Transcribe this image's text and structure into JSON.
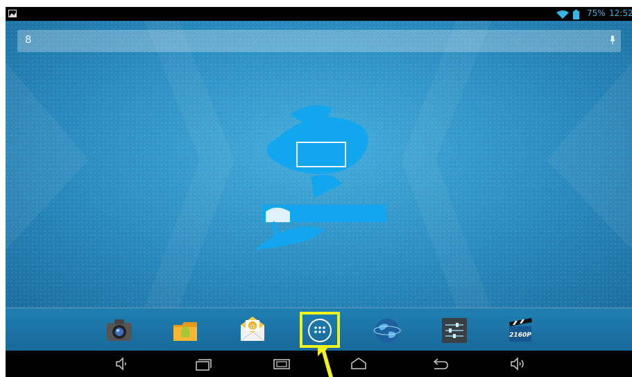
{
  "status_bar": {
    "battery_percent": "75%",
    "time": "12:52",
    "icons": [
      "notification-image-icon",
      "wifi-icon",
      "battery-icon"
    ]
  },
  "search_bar": {
    "google_glyph": "8",
    "icons": [
      "google-search-icon",
      "microphone-icon"
    ]
  },
  "dock": {
    "apps": [
      "camera-icon",
      "file-manager-icon",
      "email-icon",
      "all-apps-icon",
      "browser-globe-icon",
      "settings-icon",
      "video-player-icon"
    ],
    "video_player_badge": "2160P",
    "highlighted": "all-apps-icon"
  },
  "nav_bar": {
    "buttons": [
      "volume-down-icon",
      "recent-apps-icon",
      "screenshot-icon",
      "home-icon",
      "back-icon",
      "volume-up-icon"
    ]
  },
  "colors": {
    "status_text": "#33b5e5",
    "highlight": "#f0f21e",
    "wallpaper": "#2b8cc0"
  }
}
